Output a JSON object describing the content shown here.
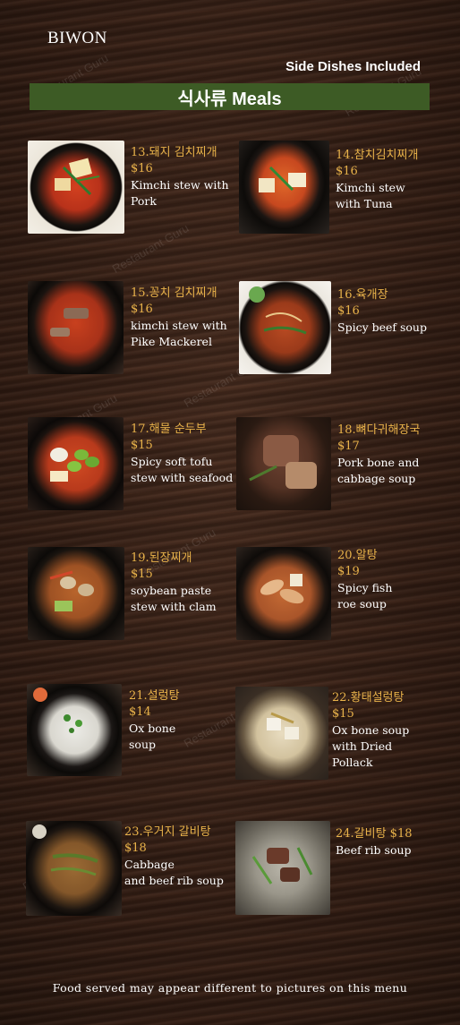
{
  "brand": "BIWON",
  "side_dishes": "Side Dishes Included",
  "section_title": "식사류 Meals",
  "items": [
    {
      "name": "13.돼지 김치찌개",
      "price": "$16",
      "desc": "Kimchi stew with\nPork"
    },
    {
      "name": "14.참치김치찌개",
      "price": "$16",
      "desc": "Kimchi stew\n with Tuna"
    },
    {
      "name": "15.꽁치 김치찌개",
      "price": "$16",
      "desc": "kimchi stew with\nPike Mackerel"
    },
    {
      "name": "16.육개장",
      "price": "$16",
      "desc": "Spicy beef soup"
    },
    {
      "name": "17.해물 순두부",
      "price": "$15",
      "desc": "Spicy soft tofu\nstew with seafood"
    },
    {
      "name": "18.뼈다귀해장국",
      "price": "$17",
      "desc": "Pork bone and\ncabbage soup"
    },
    {
      "name": "19.된장찌개",
      "price": "$15",
      "desc": "soybean paste\nstew with clam"
    },
    {
      "name": "20.알탕",
      "price": "$19",
      "desc": "Spicy fish\nroe soup"
    },
    {
      "name": "21.설렁탕",
      "price": "$14",
      "desc": "Ox bone\nsoup"
    },
    {
      "name": "22.황태설렁탕",
      "price": "$15",
      "desc": "Ox bone soup\n with Dried\nPollack"
    },
    {
      "name": "23.우거지 갈비탕",
      "price": "$18",
      "desc": "Cabbage\n and beef rib soup"
    },
    {
      "name": "24.갈비탕 $18",
      "price": "",
      "desc": "Beef rib soup"
    }
  ],
  "footer": "Food served may appear different to pictures on this menu",
  "watermark": "Restaurant Guru",
  "colors": {
    "name_text": "#e8b24a",
    "header_bar": "#3d5b25",
    "background": "#2e1b13"
  }
}
